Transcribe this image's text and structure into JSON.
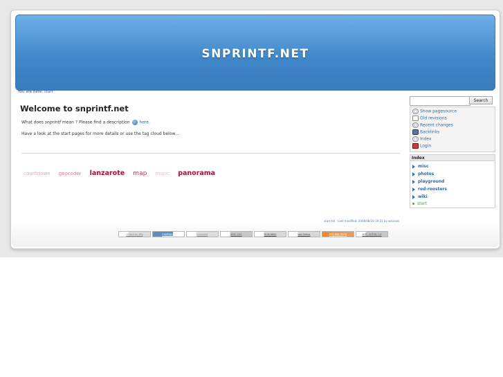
{
  "header": {
    "site_title": "SNPRINTF.NET"
  },
  "breadcrumb": {
    "prefix": "You are here:",
    "current": "start"
  },
  "main": {
    "title": "Welcome to snprintf.net",
    "para1_before": "What does",
    "para1_term": "snprintf",
    "para1_middle": "mean ? Please find a description",
    "para1_link": "here",
    "para1_after": ".",
    "para2": "Have a look at the start pages for more details or use the tag cloud below…",
    "tags": [
      {
        "label": "countdown",
        "weight": 1
      },
      {
        "label": "geocoder",
        "weight": 2
      },
      {
        "label": "lanzarote",
        "weight": 3
      },
      {
        "label": "map",
        "weight": 4
      },
      {
        "label": "music",
        "weight": 5
      },
      {
        "label": "panorama",
        "weight": 3
      }
    ],
    "page_info": "start.txt · Last modified: 2008/08/26 19:21 by wikiroot"
  },
  "sidebar": {
    "search_button": "Search",
    "search_value": "",
    "tools": [
      {
        "label": "Show pagesource",
        "icon": "page-source-icon"
      },
      {
        "label": "Old revisions",
        "icon": "old-revisions-icon"
      },
      {
        "label": "Recent changes",
        "icon": "recent-changes-icon"
      },
      {
        "label": "Backlinks",
        "icon": "backlinks-icon"
      },
      {
        "label": "Index",
        "icon": "index-icon"
      },
      {
        "label": "Login",
        "icon": "login-icon"
      }
    ],
    "index_title": "Index",
    "index_items": [
      {
        "label": "misc",
        "current": false
      },
      {
        "label": "photos",
        "current": false
      },
      {
        "label": "playground",
        "current": false
      },
      {
        "label": "red-roosters",
        "current": false
      },
      {
        "label": "wiki",
        "current": false
      },
      {
        "label": "start",
        "current": true
      }
    ]
  },
  "footer": {
    "badges": [
      "Driven by DW",
      "CAMPAIGN",
      "Licensed",
      "W3C CSS",
      "DOKUWIKI",
      "get firefox",
      "RSS XML FEED",
      "W3C XHTML 1.0"
    ]
  }
}
